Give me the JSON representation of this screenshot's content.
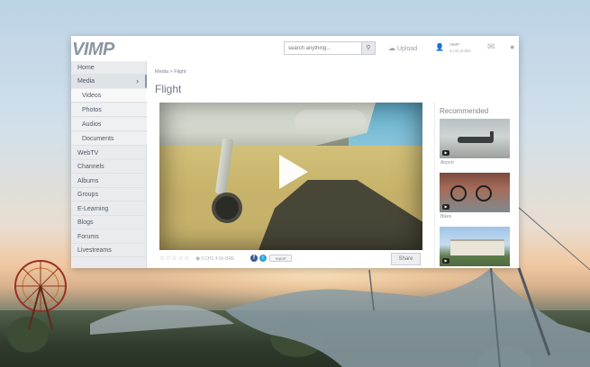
{
  "app": {
    "logo": "VIMP",
    "search_placeholder": "search anything...",
    "upload_label": "Upload",
    "user_name": "VIMP",
    "user_sub": "& mit profile"
  },
  "sidebar": {
    "items": [
      {
        "label": "Home"
      },
      {
        "label": "Media"
      },
      {
        "label": "Videos"
      },
      {
        "label": "Photos"
      },
      {
        "label": "Audios"
      },
      {
        "label": "Documents"
      },
      {
        "label": "WebTV"
      },
      {
        "label": "Channels"
      },
      {
        "label": "Albums"
      },
      {
        "label": "Groups"
      },
      {
        "label": "E-Learning"
      },
      {
        "label": "Blogs"
      },
      {
        "label": "Forums"
      },
      {
        "label": "Livestreams"
      }
    ]
  },
  "main": {
    "breadcrumb": "Media > Flight",
    "title": "Flight",
    "meta": {
      "stars": "☆☆☆☆☆",
      "views": "0   CH1   4-5h   BRE"
    },
    "report_label": "report",
    "share_label": "Share"
  },
  "recommended": {
    "title": "Recommended",
    "items": [
      {
        "label": "Airport"
      },
      {
        "label": "Bikes"
      },
      {
        "label": ""
      }
    ]
  }
}
